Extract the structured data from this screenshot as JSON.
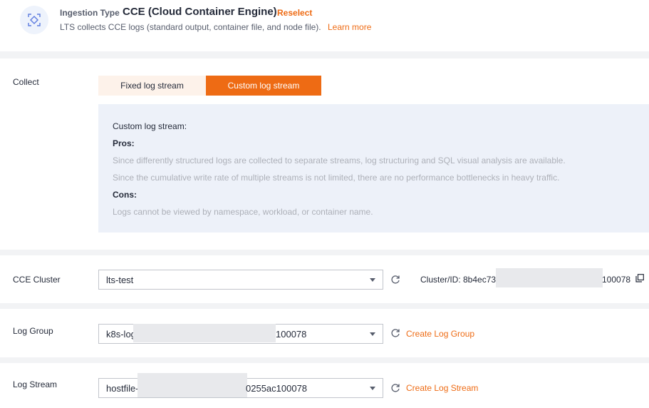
{
  "header": {
    "ingestion_label": "Ingestion Type",
    "ingestion_value": "CCE (Cloud Container Engine)",
    "reselect": "Reselect",
    "description": "LTS collects CCE logs (standard output, container file, and node file).",
    "learn_more": "Learn more",
    "icon": "scan-target-icon"
  },
  "collect": {
    "label": "Collect",
    "options": [
      "Fixed log stream",
      "Custom log stream"
    ],
    "selected": "Custom log stream",
    "info": {
      "title": "Custom log stream:",
      "pros_label": "Pros:",
      "pros": [
        "Since differently structured logs are collected to separate streams, log structuring and SQL visual analysis are available.",
        "Since the cumulative write rate of multiple streams is not limited, there are no performance bottlenecks in heavy traffic."
      ],
      "cons_label": "Cons:",
      "cons": [
        "Logs cannot be viewed by namespace, workload, or container name."
      ]
    }
  },
  "cluster": {
    "label": "CCE Cluster",
    "value": "lts-test",
    "id_prefix": "Cluster/ID: 8b4ec73",
    "id_suffix": "100078"
  },
  "log_group": {
    "label": "Log Group",
    "value_prefix": "k8s-log",
    "value_suffix": "100078",
    "create": "Create Log Group"
  },
  "log_stream": {
    "label": "Log Stream",
    "value_prefix": "hostfile-",
    "value_suffix": "0255ac100078",
    "create": "Create Log Stream"
  },
  "colors": {
    "accent": "#ee6b14",
    "info_bg": "#edf1f9",
    "page_bg": "#f2f3f5"
  }
}
